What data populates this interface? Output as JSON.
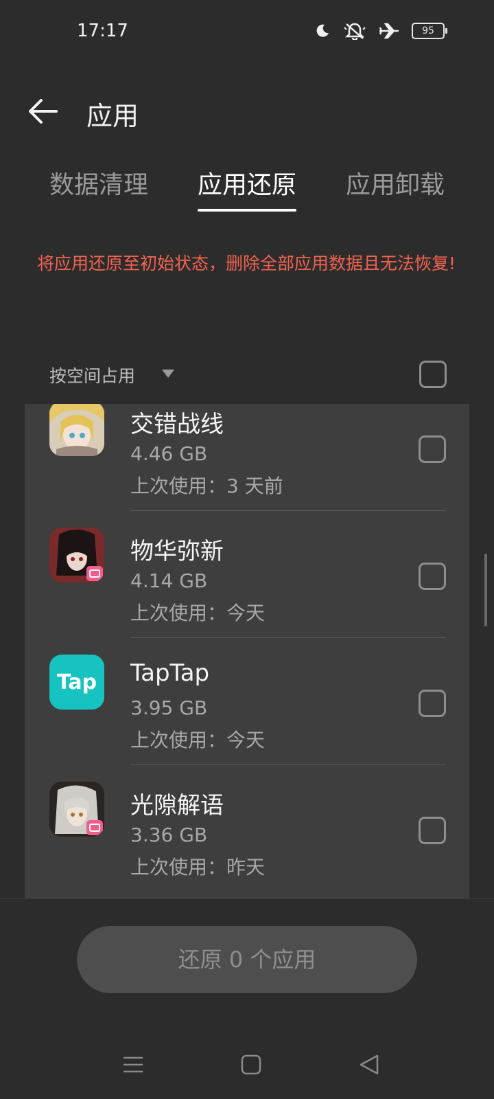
{
  "status_bar": {
    "time": "17:17",
    "battery": "95",
    "icons": [
      "moon-icon",
      "mute-icon",
      "airplane-icon",
      "battery-icon"
    ]
  },
  "header": {
    "title": "应用",
    "back_icon": "arrow-left-icon"
  },
  "tabs": [
    {
      "label": "数据清理",
      "active": false
    },
    {
      "label": "应用还原",
      "active": true
    },
    {
      "label": "应用卸载",
      "active": false
    }
  ],
  "warning": "将应用还原至初始状态，删除全部应用数据且无法恢复!",
  "sort": {
    "label": "按空间占用",
    "icon": "caret-down-icon"
  },
  "apps": [
    {
      "name": "交错战线",
      "size": "4.46 GB",
      "last_used": "上次使用：3 天前",
      "checked": false
    },
    {
      "name": "物华弥新",
      "size": "4.14 GB",
      "last_used": "上次使用：今天",
      "checked": false
    },
    {
      "name": "TapTap",
      "size": "3.95 GB",
      "last_used": "上次使用：今天",
      "checked": false,
      "icon_text": "Tap"
    },
    {
      "name": "光隙解语",
      "size": "3.36 GB",
      "last_used": "上次使用：昨天",
      "checked": false
    }
  ],
  "restore_button": "还原 0 个应用",
  "nav_bar": [
    "menu-icon",
    "home-icon",
    "back-icon"
  ],
  "colors": {
    "background": "#2c2c2c",
    "panel": "#3e3e3e",
    "warning": "#f2624f",
    "taptap": "#16c3c0"
  }
}
